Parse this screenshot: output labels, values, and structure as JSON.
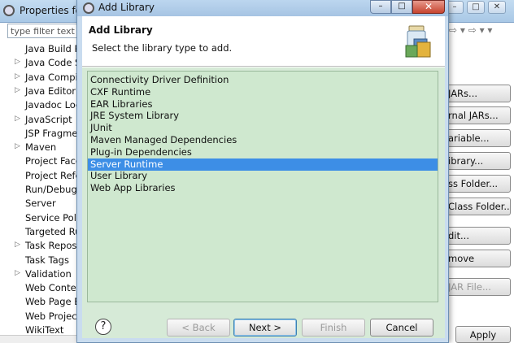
{
  "background_window": {
    "title": "Properties for",
    "filter_placeholder": "type filter text",
    "tree_items": [
      {
        "label": "Java Build Pa",
        "expandable": false
      },
      {
        "label": "Java Code St",
        "expandable": true
      },
      {
        "label": "Java Compile",
        "expandable": true
      },
      {
        "label": "Java Editor",
        "expandable": true
      },
      {
        "label": "Javadoc Loc",
        "expandable": false
      },
      {
        "label": "JavaScript",
        "expandable": true
      },
      {
        "label": "JSP Fragmen",
        "expandable": false
      },
      {
        "label": "Maven",
        "expandable": true
      },
      {
        "label": "Project Facet",
        "expandable": false
      },
      {
        "label": "Project Refer",
        "expandable": false
      },
      {
        "label": "Run/Debug S",
        "expandable": false
      },
      {
        "label": "Server",
        "expandable": false
      },
      {
        "label": "Service Polic",
        "expandable": false
      },
      {
        "label": "Targeted Ru",
        "expandable": false
      },
      {
        "label": "Task Reposit",
        "expandable": true
      },
      {
        "label": "Task Tags",
        "expandable": false
      },
      {
        "label": "Validation",
        "expandable": true
      },
      {
        "label": "Web Conten",
        "expandable": false
      },
      {
        "label": "Web Page E",
        "expandable": false
      },
      {
        "label": "Web Project",
        "expandable": false
      },
      {
        "label": "WikiText",
        "expandable": false
      }
    ],
    "right_buttons": [
      {
        "label": "JARs...",
        "enabled": true
      },
      {
        "label": "rnal JARs...",
        "enabled": true
      },
      {
        "label": "ariable...",
        "enabled": true
      },
      {
        "label": "ibrary...",
        "enabled": true
      },
      {
        "label": "ss Folder...",
        "enabled": true
      },
      {
        "label": "Class Folder...",
        "enabled": true
      },
      {
        "label": "dit...",
        "enabled": true
      },
      {
        "label": "move",
        "enabled": true
      },
      {
        "label": "JAR File...",
        "enabled": false
      }
    ],
    "apply_label": "Apply"
  },
  "dialog": {
    "title": "Add Library",
    "header_title": "Add Library",
    "header_description": "Select the library type to add.",
    "library_types": [
      "Connectivity Driver Definition",
      "CXF Runtime",
      "EAR Libraries",
      "JRE System Library",
      "JUnit",
      "Maven Managed Dependencies",
      "Plug-in Dependencies",
      "Server Runtime",
      "User Library",
      "Web App Libraries"
    ],
    "selected_index": 7,
    "buttons": {
      "back": "< Back",
      "next": "Next >",
      "finish": "Finish",
      "cancel": "Cancel"
    },
    "help_symbol": "?"
  },
  "colors": {
    "selection": "#3d8ee6",
    "list_background": "#cfe8cf",
    "dialog_frame": "#c9dcef"
  }
}
